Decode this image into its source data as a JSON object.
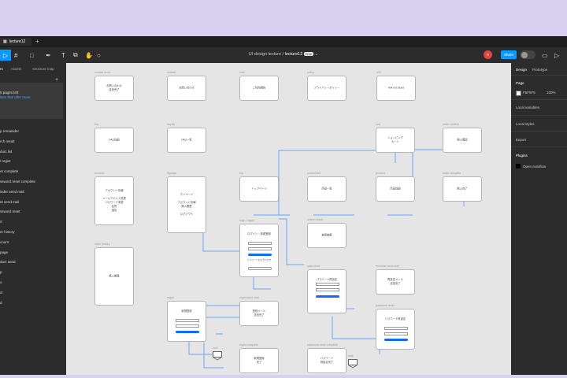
{
  "tabbar": {
    "tab_label": "lecture12",
    "plus": "+"
  },
  "toolbar": {
    "breadcrumb_project": "UI design lecture",
    "separator": "/",
    "file_name": "lecture12",
    "free_badge": "Free",
    "avatar": "R",
    "share_label": "Share",
    "toggle_label": "▷"
  },
  "left_panel": {
    "tabs": [
      "rs",
      "Assets",
      "structure map"
    ],
    "pages_title": "cture map",
    "pages_line1": "5 pages left",
    "pages_line2": "lans that offer more",
    "plus": "+",
    "layers": [
      "p remainder",
      "rch result",
      "duct list",
      "/ regist",
      "et complete",
      "ssword reset complete",
      "inder send mail",
      "et send mail",
      "ssword reset",
      "rt",
      "er history",
      "count",
      "page",
      "duct send",
      "p",
      "o",
      "ct",
      "d"
    ]
  },
  "right_panel": {
    "tab_design": "Design",
    "tab_prototype": "Prototype",
    "page_title": "Page",
    "color_hex": "F5F5F5",
    "opacity": "100%",
    "local_variables": "Local variables",
    "local_styles": "Local styles",
    "export": "Export",
    "plugins": "Plugins",
    "plugin_name": "Open Autoflow"
  },
  "frames": [
    {
      "id": "contact-send",
      "label": "contact send",
      "text": "お問い合わせ\n送信完了"
    },
    {
      "id": "contact",
      "label": "contact",
      "text": "お問い合わせ"
    },
    {
      "id": "note",
      "label": "note",
      "text": "ご利用規約"
    },
    {
      "id": "policy",
      "label": "policy",
      "text": "プライバシーポリシー"
    },
    {
      "id": "404",
      "label": "404",
      "text": "404 not found"
    },
    {
      "id": "faq",
      "label": "faq",
      "text": "FAQ詳細"
    },
    {
      "id": "faq-list",
      "label": "faq list",
      "text": "FAQ一覧"
    },
    {
      "id": "cart",
      "label": "cart",
      "text": "ショッピング\nカート"
    },
    {
      "id": "order-confirm",
      "label": "order confirm",
      "text": "購入確認"
    },
    {
      "id": "account",
      "label": "account",
      "text": "アカウント情報\n\nメールアドレス変更\nパスワード変更\n住所\n退会"
    },
    {
      "id": "mypage",
      "label": "Mypage",
      "text": "マイページ\n\nアカウント情報\n購入履歴\n\nログアウト"
    },
    {
      "id": "top",
      "label": "top",
      "text": "トップページ"
    },
    {
      "id": "product-list",
      "label": "product list",
      "text": "商品一覧"
    },
    {
      "id": "product",
      "label": "product",
      "text": "商品詳細"
    },
    {
      "id": "order-complete",
      "label": "order complete",
      "text": "購入完了"
    },
    {
      "id": "search-result",
      "label": "search result",
      "text": "検索結果"
    },
    {
      "id": "order-history",
      "label": "order history",
      "text": "購入履歴"
    },
    {
      "id": "login",
      "label": "login / regist",
      "text": "ログイン・新規登録"
    },
    {
      "id": "pass-reset",
      "label": "pass reset",
      "text": "パスワード再設定"
    },
    {
      "id": "reminder-send",
      "label": "reminder send mail",
      "text": "再設定メール\n送信完了"
    },
    {
      "id": "regist",
      "label": "regist",
      "text": "新規登録"
    },
    {
      "id": "regist-send",
      "label": "regist send mail",
      "text": "登録メール\n送信完了"
    },
    {
      "id": "password-reset",
      "label": "password reset",
      "text": "パスワード再設定"
    },
    {
      "id": "regist-complete",
      "label": "regist complete",
      "text": "新規登録\n完了"
    },
    {
      "id": "password-reset-complete",
      "label": "password reset complete",
      "text": "パスワード\n再設定完了"
    }
  ],
  "link_labels": {
    "login_forgot": "パスワードをお忘れの方",
    "mail1": "mail",
    "mail2": "mail"
  }
}
